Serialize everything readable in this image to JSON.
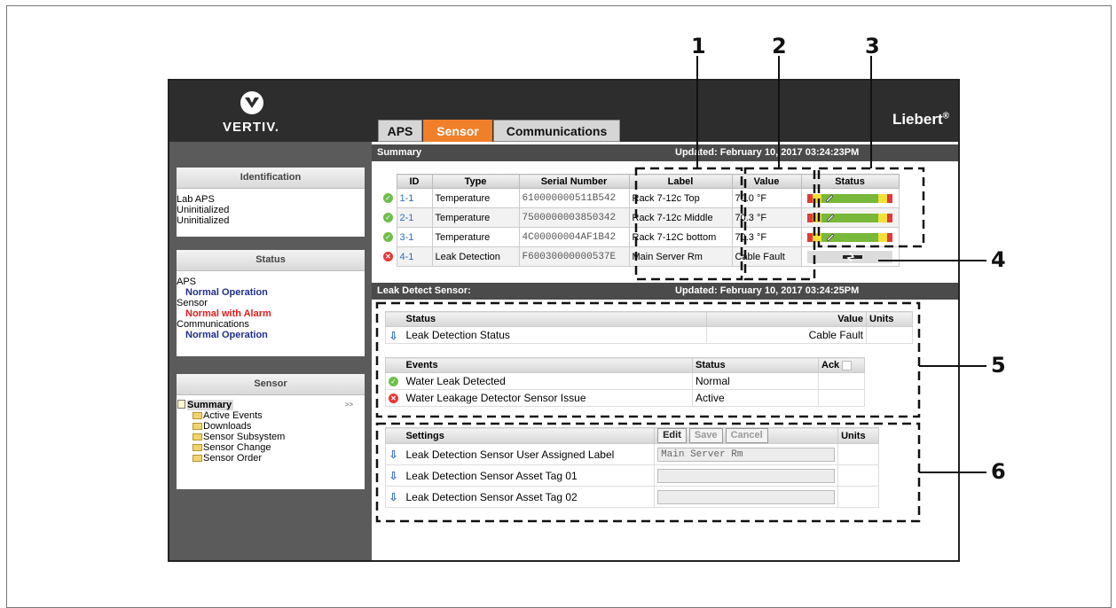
{
  "brand": {
    "logo_text": "VERTIV.",
    "product": "Liebert",
    "product_mark": "®"
  },
  "tabs": [
    {
      "label": "APS",
      "active": false
    },
    {
      "label": "Sensor",
      "active": true
    },
    {
      "label": "Communications",
      "active": false
    }
  ],
  "sidebar": {
    "identification": {
      "title": "Identification",
      "lines": [
        "Lab APS",
        "Uninitialized",
        "Uninitialized"
      ]
    },
    "status": {
      "title": "Status",
      "items": [
        {
          "label": "APS",
          "value": "Normal Operation",
          "alarm": false
        },
        {
          "label": "Sensor",
          "value": "Normal with Alarm",
          "alarm": true
        },
        {
          "label": "Communications",
          "value": "Normal Operation",
          "alarm": false
        }
      ]
    },
    "sensor": {
      "title": "Sensor",
      "selected": "Summary",
      "expander": ">>",
      "items": [
        "Active Events",
        "Downloads",
        "Sensor Subsystem",
        "Sensor Change",
        "Sensor Order"
      ]
    }
  },
  "summary": {
    "title": "Summary",
    "updated": "Updated: February 10, 2017 03:24:23PM",
    "columns": [
      "ID",
      "Type",
      "Serial Number",
      "Label",
      "Value",
      "Status"
    ],
    "rows": [
      {
        "state": "ok",
        "id": "1-1",
        "type": "Temperature",
        "serial": "610000000511B542",
        "label": "Rack 7-12c Top",
        "value": "70.0 °F",
        "level": 0.26
      },
      {
        "state": "ok",
        "id": "2-1",
        "type": "Temperature",
        "serial": "7500000003850342",
        "label": "Rack 7-12c Middle",
        "value": "70.3 °F",
        "level": 0.27
      },
      {
        "state": "ok",
        "id": "3-1",
        "type": "Temperature",
        "serial": "4C00000004AF1B42",
        "label": "Rack 7-12C bottom",
        "value": "70.3 °F",
        "level": 0.27
      },
      {
        "state": "alarm",
        "id": "4-1",
        "type": "Leak Detection",
        "serial": "F60030000000537E",
        "label": "Main Server Rm",
        "value": "Cable Fault",
        "level": null
      }
    ]
  },
  "leak": {
    "title": "Leak Detect Sensor:",
    "updated": "Updated: February 10, 2017 03:24:25PM",
    "status_table": {
      "headers": [
        "Status",
        "Value",
        "Units"
      ],
      "rows": [
        {
          "label": "Leak Detection Status",
          "value": "Cable Fault",
          "units": ""
        }
      ]
    },
    "events_table": {
      "headers": [
        "Events",
        "Status",
        "Ack"
      ],
      "rows": [
        {
          "state": "ok",
          "label": "Water Leak Detected",
          "status": "Normal"
        },
        {
          "state": "alarm",
          "label": "Water Leakage Detector Sensor Issue",
          "status": "Active"
        }
      ]
    },
    "settings_table": {
      "headers": [
        "Settings",
        "Units"
      ],
      "buttons": [
        "Edit",
        "Save",
        "Cancel"
      ],
      "rows": [
        {
          "label": "Leak Detection Sensor User Assigned Label",
          "value": "Main Server Rm"
        },
        {
          "label": "Leak Detection Sensor Asset Tag 01",
          "value": ""
        },
        {
          "label": "Leak Detection Sensor Asset Tag 02",
          "value": ""
        }
      ]
    }
  },
  "callouts": [
    "1",
    "2",
    "3",
    "4",
    "5",
    "6"
  ],
  "colors": {
    "accent": "#f07f2a",
    "status_blue": "#1f2f8e",
    "alarm_red": "#e81b1b",
    "bar_green": "#78b83a",
    "bar_yellow": "#f3e03a",
    "bar_red": "#e23a3a"
  }
}
